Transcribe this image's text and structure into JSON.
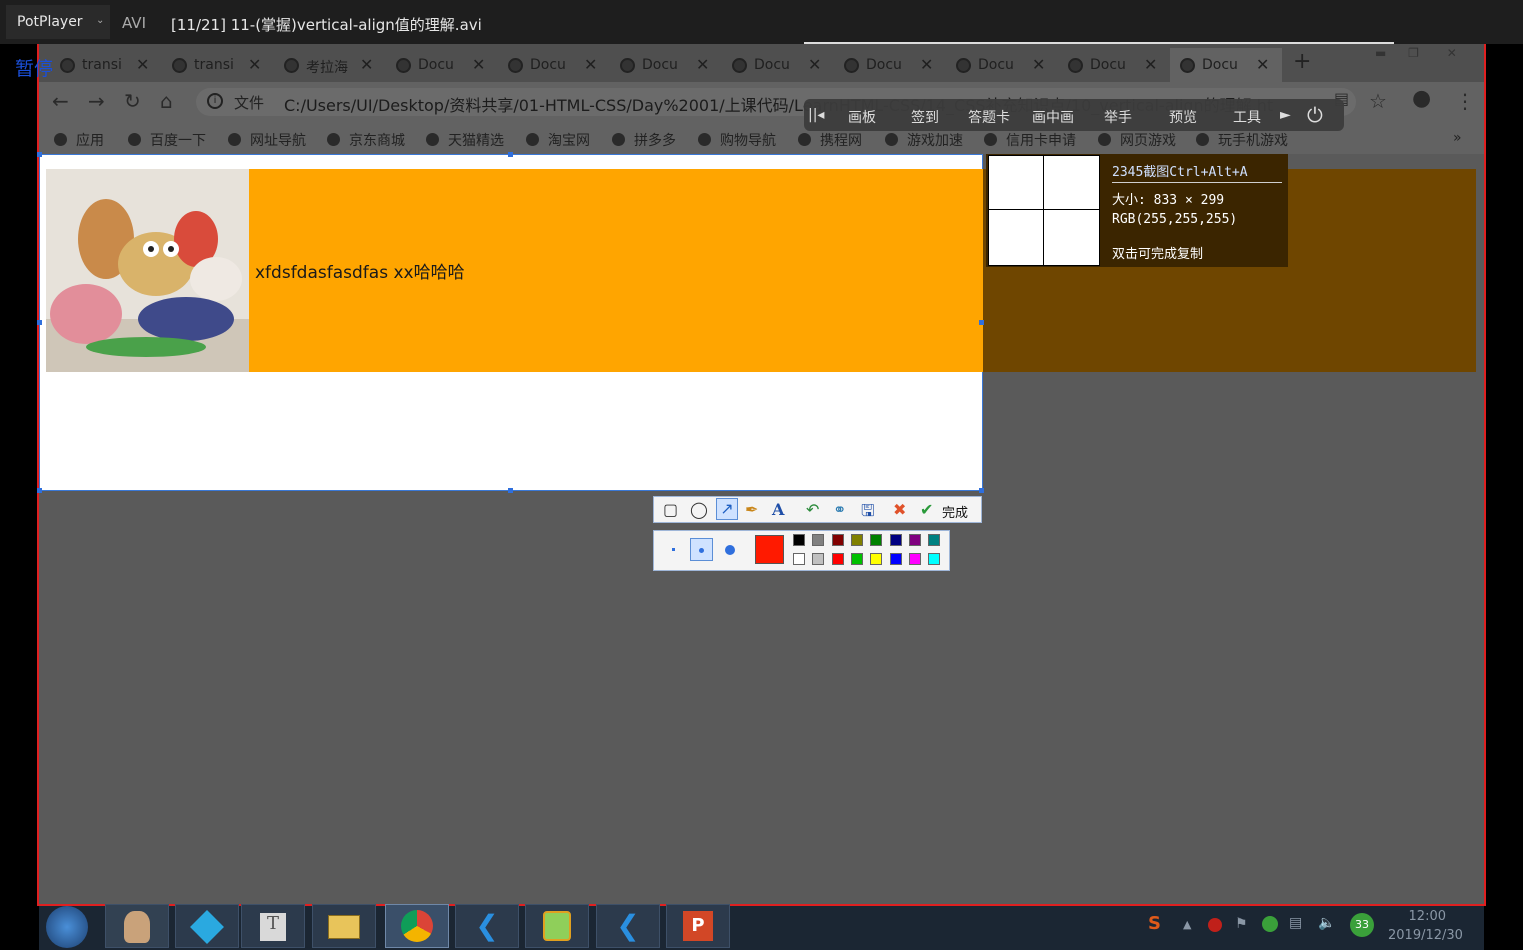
{
  "player": {
    "menu_label": "PotPlayer",
    "format": "AVI",
    "title": "[11/21] 11-(掌握)vertical-align值的理解.avi",
    "state_label": "暂停"
  },
  "browser": {
    "tabs": [
      {
        "title": "transi"
      },
      {
        "title": "transi"
      },
      {
        "title": "考拉海"
      },
      {
        "title": "Docu"
      },
      {
        "title": "Docu"
      },
      {
        "title": "Docu"
      },
      {
        "title": "Docu"
      },
      {
        "title": "Docu"
      },
      {
        "title": "Docu"
      },
      {
        "title": "Docu"
      },
      {
        "title": "Docu"
      }
    ],
    "new_tab_label": "+",
    "address_prefix": "文件",
    "url": "C:/Users/UI/Desktop/资料共享/01-HTML-CSS/Day%2001/上课代码/LearnHTML-CSS/14_CSS补充知识点/10_vertical-align的理解.html",
    "bookmarks": [
      "应用",
      "百度一下",
      "网址导航",
      "京东商城",
      "天猫精选",
      "淘宝网",
      "拼多多",
      "购物导航",
      "携程网",
      "游戏加速",
      "信用卡申请",
      "网页游戏",
      "玩手机游戏"
    ],
    "more_bookmarks": "»"
  },
  "float_panel": {
    "items": [
      "画板",
      "签到",
      "答题卡",
      "画中画",
      "举手",
      "预览",
      "工具"
    ]
  },
  "page": {
    "box_text": "xfdsfdasfasdfas xx哈哈哈"
  },
  "magnifier": {
    "title": "2345截图Ctrl+Alt+A",
    "size": "大小: 833 × 299",
    "rgb": "RGB(255,255,255)",
    "hint": "双击可完成复制"
  },
  "capture_toolbar": {
    "done_label": "完成",
    "swatches_top": [
      "#000000",
      "#808080",
      "#800000",
      "#808000",
      "#008000",
      "#000080",
      "#800080",
      "#008080"
    ],
    "swatches_bottom": [
      "#ffffff",
      "#c0c0c0",
      "#ff0000",
      "#00c000",
      "#ffff00",
      "#0000ff",
      "#ff00ff",
      "#00ffff"
    ],
    "current_color": "#ff1a00"
  },
  "taskbar": {
    "time": "12:00",
    "date": "2019/12/30",
    "badge": "33"
  }
}
